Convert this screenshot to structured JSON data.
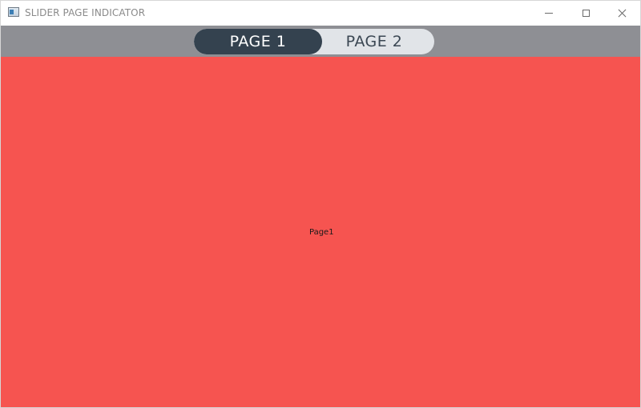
{
  "window": {
    "title": "SLIDER PAGE INDICATOR"
  },
  "indicator": {
    "pages": [
      "PAGE 1",
      "PAGE 2"
    ],
    "active_index": 0
  },
  "page": {
    "label": "Page1",
    "background": "#f65450"
  },
  "colors": {
    "header": "#8e8f94",
    "active_segment": "#34424f",
    "inactive_segment": "#e1e4e8"
  },
  "icons": {
    "app": "window-app-icon",
    "minimize": "minimize-icon",
    "maximize": "maximize-icon",
    "close": "close-icon"
  }
}
